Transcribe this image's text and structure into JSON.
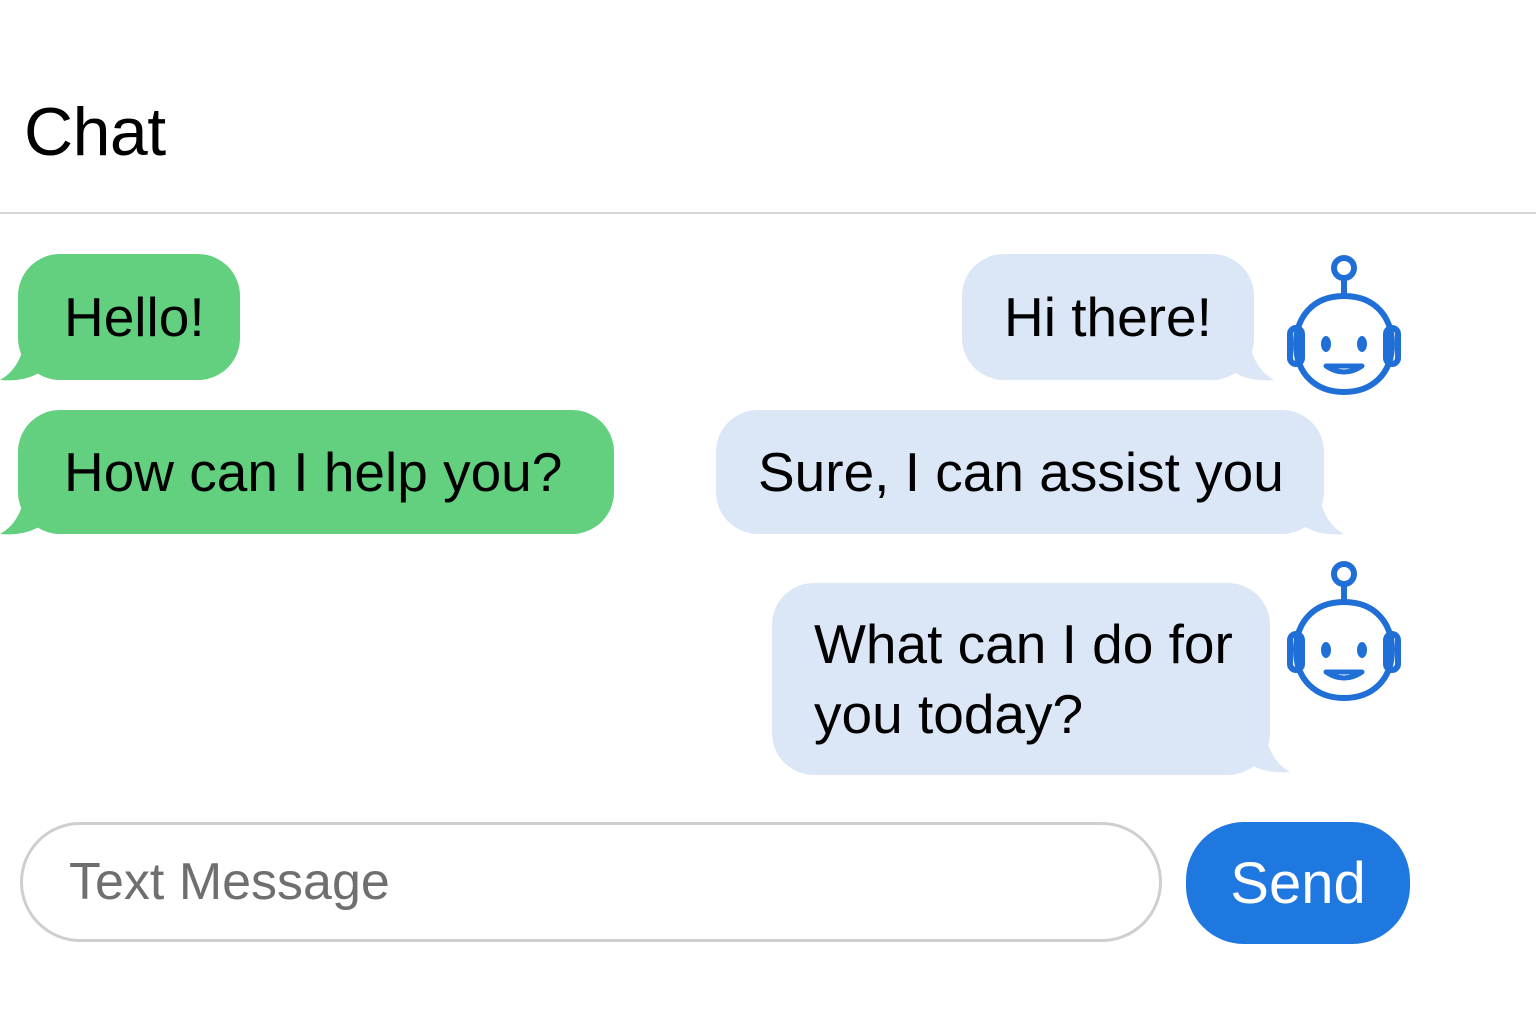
{
  "header": {
    "title": "Chat"
  },
  "messages": [
    {
      "sender": "user",
      "text": "Hello!"
    },
    {
      "sender": "user",
      "text": "How can I help you?"
    },
    {
      "sender": "bot",
      "text": "Hi there!"
    },
    {
      "sender": "bot",
      "text": "Sure, I can assist you"
    },
    {
      "sender": "bot",
      "text": "What can I do for you today?",
      "lines": [
        "What can I do for",
        "you today?"
      ]
    }
  ],
  "composer": {
    "placeholder": "Text Message",
    "value": "",
    "send_label": "Send"
  },
  "colors": {
    "user_bubble": "#62d07f",
    "bot_bubble": "#dbe7f6",
    "accent": "#1f78df",
    "bot_icon": "#1f6fd6"
  },
  "icons": {
    "bot_avatar": "robot-icon"
  }
}
